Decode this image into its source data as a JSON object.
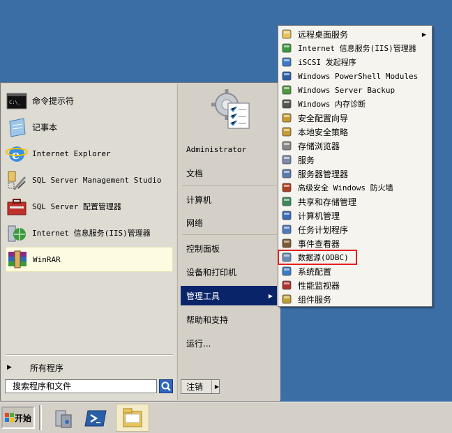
{
  "start_menu": {
    "pinned": [
      {
        "label": "命令提示符",
        "icon": "command-prompt-icon"
      },
      {
        "label": "记事本",
        "icon": "notepad-icon"
      },
      {
        "label": "Internet Explorer",
        "icon": "internet-explorer-icon"
      },
      {
        "label": "SQL Server Management Studio",
        "icon": "sql-management-studio-icon"
      },
      {
        "label": "SQL Server 配置管理器",
        "icon": "sql-config-manager-icon"
      },
      {
        "label": "Internet 信息服务(IIS)管理器",
        "icon": "iis-manager-icon"
      },
      {
        "label": "WinRAR",
        "icon": "winrar-icon"
      }
    ],
    "all_programs": "所有程序",
    "search_placeholder": "搜索程序和文件",
    "right": [
      {
        "label": "Administrator"
      },
      {
        "label": "文档"
      },
      {
        "label": "计算机"
      },
      {
        "label": "网络"
      },
      {
        "label": "控制面板"
      },
      {
        "label": "设备和打印机"
      },
      {
        "label": "管理工具"
      },
      {
        "label": "帮助和支持"
      },
      {
        "label": "运行..."
      }
    ],
    "logoff": "注销"
  },
  "submenu": {
    "items": [
      {
        "label": "远程桌面服务",
        "icon": "folder-icon"
      },
      {
        "label": "Internet 信息服务(IIS)管理器",
        "icon": "iis-icon"
      },
      {
        "label": "iSCSI 发起程序",
        "icon": "iscsi-icon"
      },
      {
        "label": "Windows PowerShell Modules",
        "icon": "powershell-icon"
      },
      {
        "label": "Windows Server Backup",
        "icon": "backup-icon"
      },
      {
        "label": "Windows 内存诊断",
        "icon": "memory-diagnostic-icon"
      },
      {
        "label": "安全配置向导",
        "icon": "security-wizard-icon"
      },
      {
        "label": "本地安全策略",
        "icon": "local-security-policy-icon"
      },
      {
        "label": "存储浏览器",
        "icon": "storage-explorer-icon"
      },
      {
        "label": "服务",
        "icon": "services-icon"
      },
      {
        "label": "服务器管理器",
        "icon": "server-manager-icon"
      },
      {
        "label": "高级安全 Windows 防火墙",
        "icon": "firewall-icon"
      },
      {
        "label": "共享和存储管理",
        "icon": "share-storage-icon"
      },
      {
        "label": "计算机管理",
        "icon": "computer-management-icon"
      },
      {
        "label": "任务计划程序",
        "icon": "task-scheduler-icon"
      },
      {
        "label": "事件查看器",
        "icon": "event-viewer-icon"
      },
      {
        "label": "数据源(ODBC)",
        "icon": "odbc-icon"
      },
      {
        "label": "系统配置",
        "icon": "system-config-icon"
      },
      {
        "label": "性能监视器",
        "icon": "performance-monitor-icon"
      },
      {
        "label": "组件服务",
        "icon": "component-services-icon"
      }
    ]
  },
  "taskbar": {
    "start_label": "开始",
    "icons": [
      "server-manager-taskbar-icon",
      "powershell-taskbar-icon",
      "explorer-taskbar-icon"
    ]
  },
  "colors": {
    "desktop": "#3a6ea5",
    "menu_bg": "#d4d0c8",
    "selection": "#0a246a",
    "highlight_border": "#e02020"
  }
}
